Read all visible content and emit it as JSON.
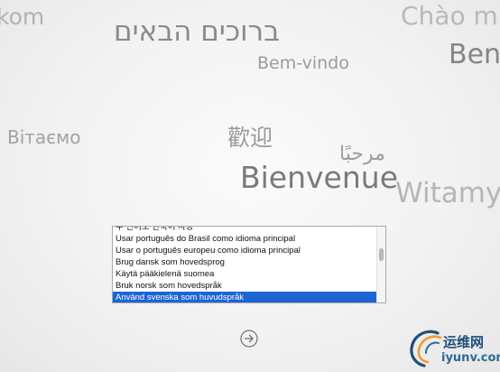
{
  "welcome_words": {
    "kom": "kom",
    "hebrew": "ברוכים הבאים",
    "chao": "Chào m",
    "ben": "Ben",
    "bem_vindo": "Bem-vindo",
    "vitaemo": "Вітаємо",
    "huanying": "歡迎",
    "marhaba": "مرحبًا",
    "bienvenue": "Bienvenue",
    "witamy": "Witamy"
  },
  "language_list": {
    "items": [
      "주 언어로 한국어 사용",
      "Usar português do Brasil como idioma principal",
      "Usar o português europeu como idioma principal",
      "Brug dansk som hovedsprog",
      "Käytä pääkielenä suomea",
      "Bruk norsk som hovedspråk",
      "Använd svenska som huvudspråk"
    ],
    "selected": "Använd svenska som huvudspråk"
  },
  "watermark": {
    "site_name": "运维网",
    "url": "iyunv.com"
  },
  "colors": {
    "selection": "#1d64d4",
    "logo_blue": "#1f4e7a",
    "logo_orange": "#f29a2e"
  }
}
